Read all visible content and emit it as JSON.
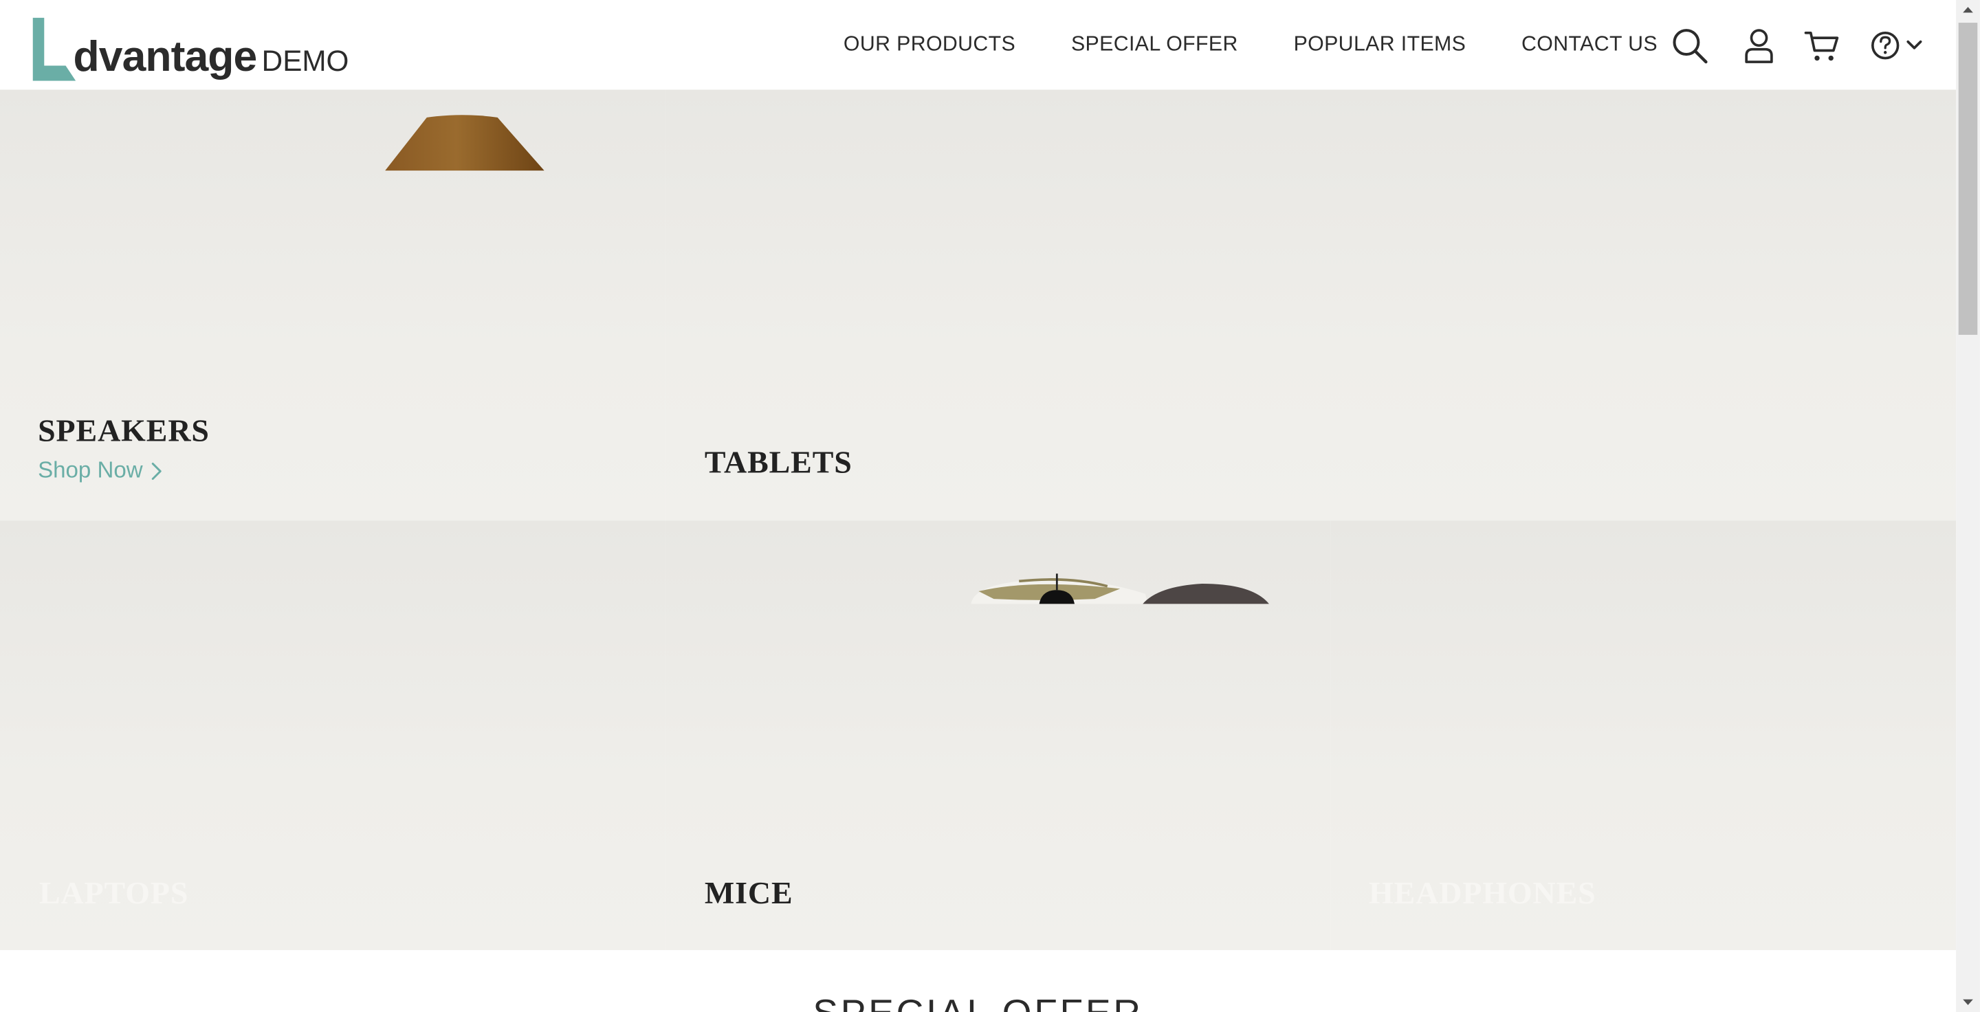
{
  "header": {
    "logo": {
      "word": "dvantage",
      "suffix": "DEMO"
    },
    "nav": [
      {
        "label": "OUR PRODUCTS"
      },
      {
        "label": "SPECIAL OFFER"
      },
      {
        "label": "POPULAR ITEMS"
      },
      {
        "label": "CONTACT US"
      }
    ],
    "icons": [
      "search-icon",
      "user-icon",
      "cart-icon",
      "help-icon",
      "chevron-down-icon"
    ]
  },
  "categories": [
    {
      "title": "SPEAKERS",
      "shop_now": "Shop Now"
    },
    {
      "title": "TABLETS"
    },
    {
      "title": "LAPTOPS"
    },
    {
      "title": "MICE"
    },
    {
      "title": "HEADPHONES"
    }
  ],
  "special_offer": {
    "title": "SPECIAL OFFER"
  },
  "colors": {
    "accent": "#6aaea6",
    "text": "#2b2b2b",
    "tile_bg": "#ecebe7"
  }
}
